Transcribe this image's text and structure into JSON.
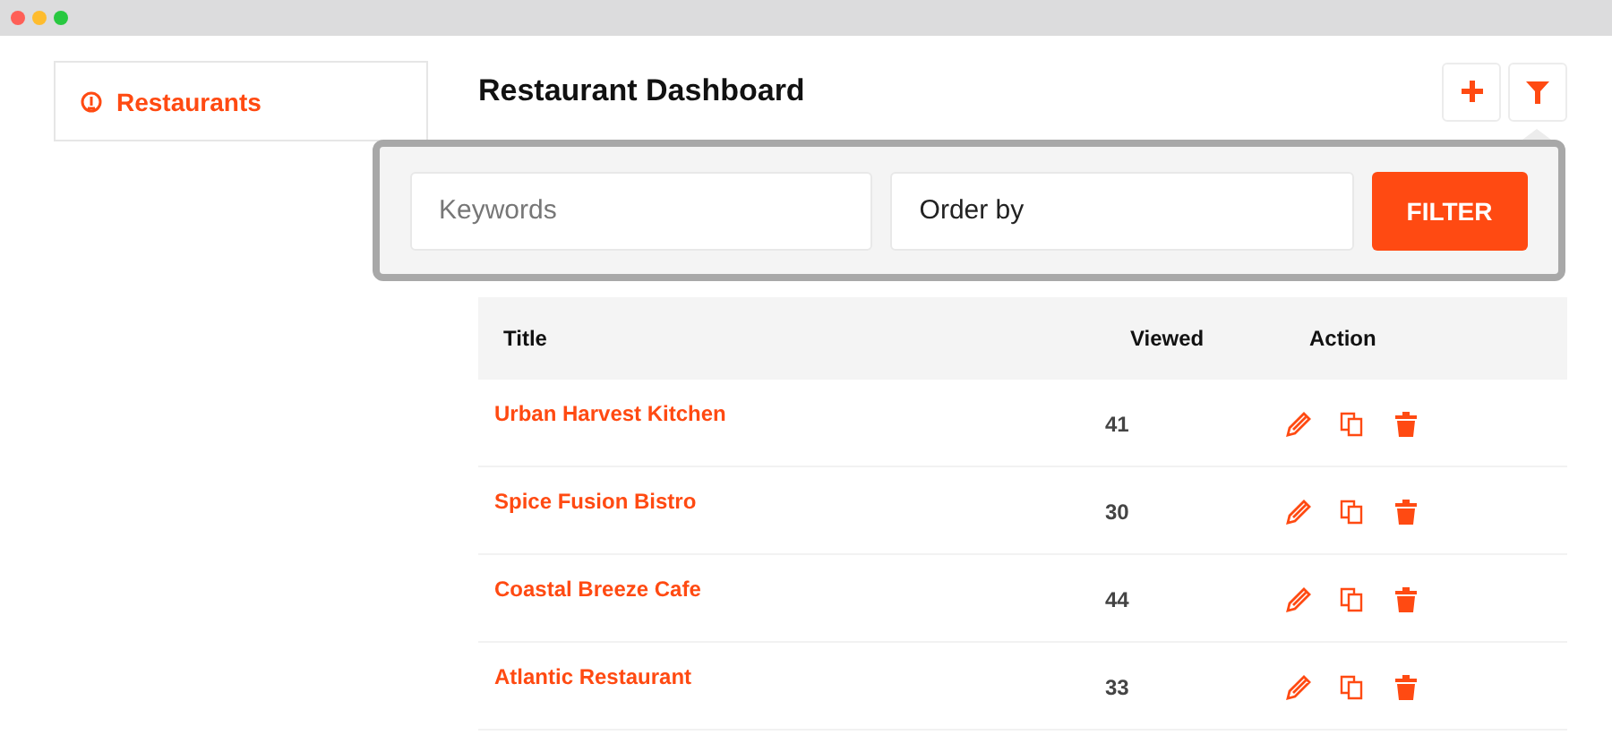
{
  "sidebar": {
    "items": [
      {
        "label": "Restaurants",
        "selected": true
      }
    ]
  },
  "header": {
    "title": "Restaurant Dashboard"
  },
  "filter_panel": {
    "keywords": {
      "placeholder": "Keywords"
    },
    "order_by": {
      "value": "Order by"
    },
    "button": "FILTER"
  },
  "table": {
    "columns": [
      "Title",
      "Viewed",
      "Action"
    ],
    "rows": [
      {
        "title": "Urban Harvest Kitchen",
        "viewed": "41"
      },
      {
        "title": "Spice Fusion Bistro",
        "viewed": "30"
      },
      {
        "title": "Coastal Breeze Cafe",
        "viewed": "44"
      },
      {
        "title": "Atlantic Restaurant",
        "viewed": "33"
      }
    ]
  }
}
